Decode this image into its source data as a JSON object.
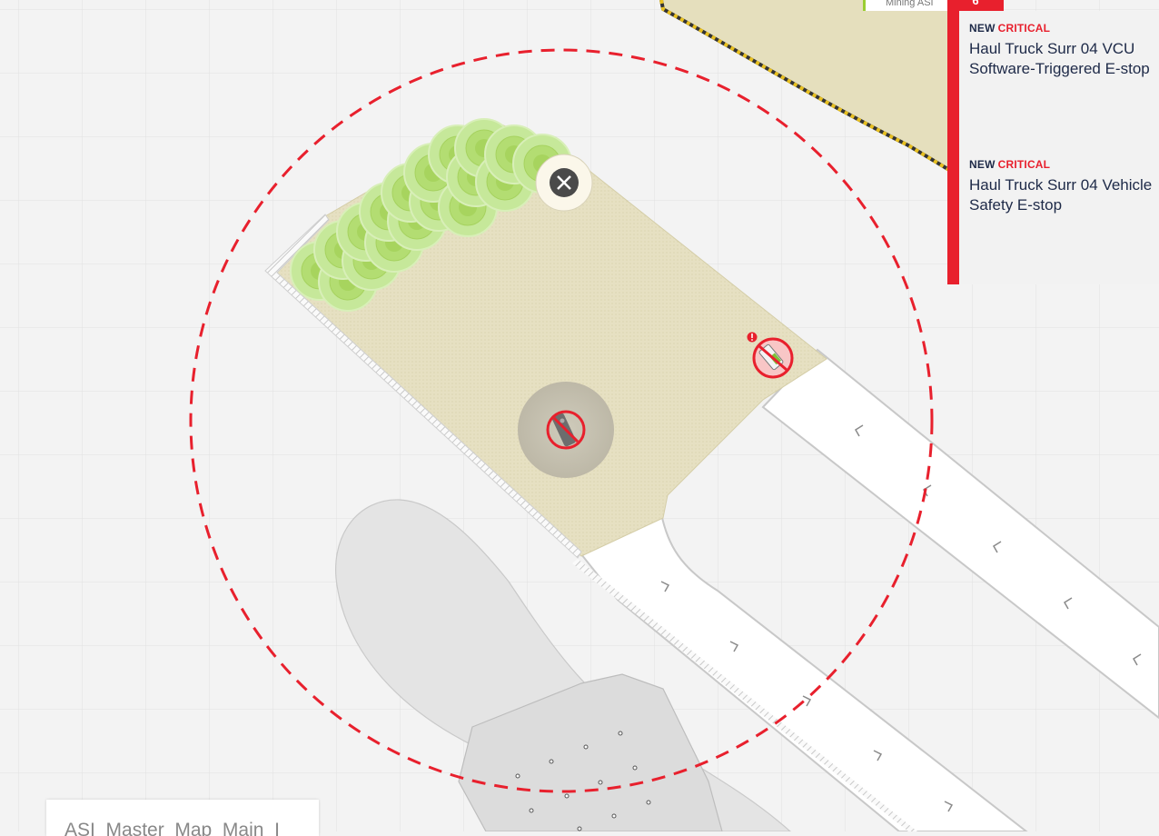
{
  "top_bar": {
    "site_label": "Mining ASI",
    "badge_count": "6"
  },
  "alerts": [
    {
      "status": "NEW",
      "severity": "CRITICAL",
      "title_line1": "Haul Truck Surr 04 VCU",
      "title_line2": "Software-Triggered E-stop"
    },
    {
      "status": "NEW",
      "severity": "CRITICAL",
      "title_line1": "Haul Truck Surr 04 Vehicle",
      "title_line2": "Safety E-stop"
    }
  ],
  "map": {
    "name_label": "ASI_Master_Map_Main_I",
    "icons": {
      "close": "close-icon",
      "alert": "exclamation-icon",
      "vehicle": "haul-truck-icon",
      "estop": "no-entry-icon"
    },
    "colors": {
      "safety_radius": "#e8202d",
      "loading_area": "#e5dfbd",
      "trees": "#b8e07a",
      "road": "#ffffff",
      "boundary_stripe": "#e8c020"
    }
  }
}
